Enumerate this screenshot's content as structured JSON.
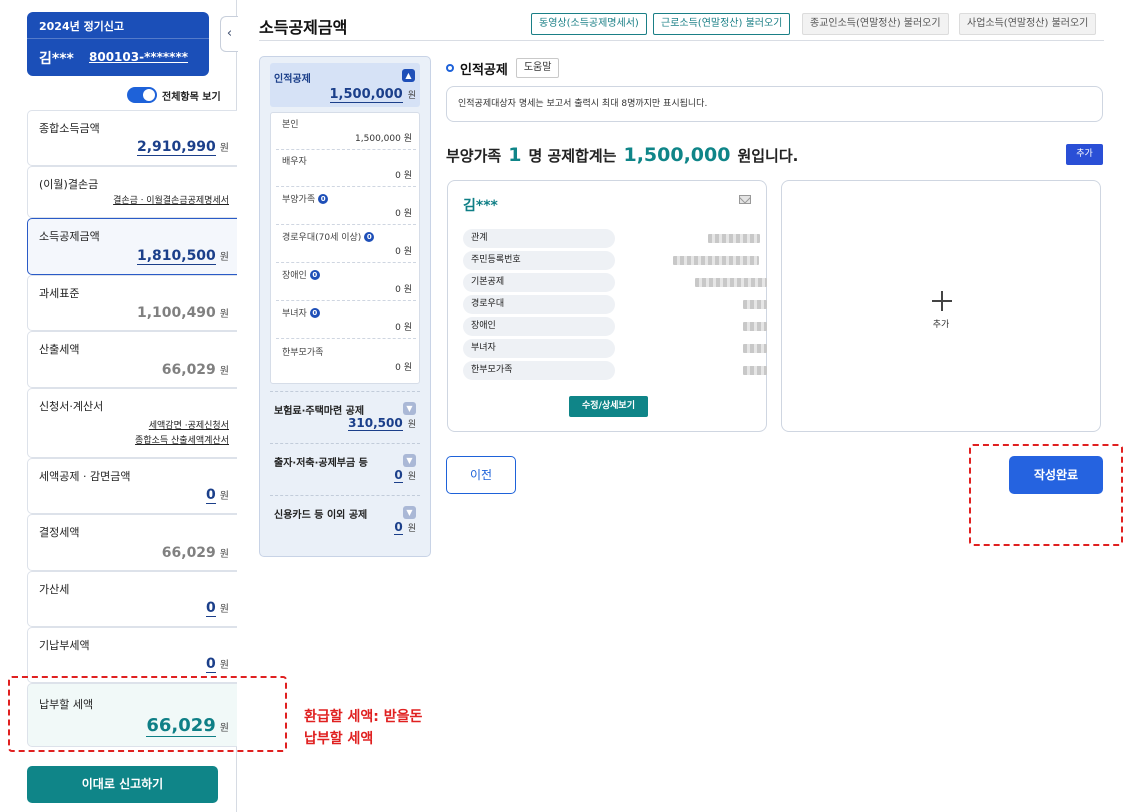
{
  "filing": {
    "year_label": "2024년 정기신고",
    "name": "김***",
    "id": "800103-*******"
  },
  "toggle": {
    "label": "전체항목 보기"
  },
  "sidebar": {
    "items": [
      {
        "title": "종합소득금액",
        "value": "2,910,990",
        "unit": "원"
      },
      {
        "title": "(이월)결손금",
        "links": [
          "결손금ㆍ이월결손금공제명세서"
        ]
      },
      {
        "title": "소득공제금액",
        "value": "1,810,500",
        "unit": "원"
      },
      {
        "title": "과세표준",
        "value": "1,100,490",
        "unit": "원"
      },
      {
        "title": "산출세액",
        "value": "66,029",
        "unit": "원"
      },
      {
        "title": "신청서·계산서",
        "links": [
          "세액감면 ·공제신청서",
          "종합소득 산출세액계산서"
        ]
      },
      {
        "title": "세액공제 · 감면금액",
        "value": "0",
        "unit": "원"
      },
      {
        "title": "결정세액",
        "value": "66,029",
        "unit": "원"
      },
      {
        "title": "가산세",
        "value": "0",
        "unit": "원"
      },
      {
        "title": "기납부세액",
        "value": "0",
        "unit": "원"
      },
      {
        "title": "납부할 세액",
        "value": "66,029",
        "unit": "원"
      }
    ],
    "report_button": "이대로 신고하기"
  },
  "annotation": {
    "line1": "환급할 세액: 받을돈",
    "line2": "납부할 세액"
  },
  "header": {
    "title": "소득공제금액",
    "buttons": [
      "동영상(소득공제명세서)",
      "근로소득(연말정산) 불러오기",
      "종교인소득(연말정산) 불러오기",
      "사업소득(연말정산) 불러오기"
    ]
  },
  "deductions": {
    "head": {
      "label": "인적공제",
      "value": "1,500,000",
      "unit": "원"
    },
    "sub_items": [
      {
        "label": "본인",
        "value": "1,500,000 원",
        "info": ""
      },
      {
        "label": "배우자",
        "value": "0 원",
        "info": ""
      },
      {
        "label": "부양가족",
        "value": "0 원",
        "info": "0"
      },
      {
        "label": "경로우대(70세 이상)",
        "value": "0 원",
        "info": "0"
      },
      {
        "label": "장애인",
        "value": "0 원",
        "info": "0"
      },
      {
        "label": "부녀자",
        "value": "0 원",
        "info": "0"
      },
      {
        "label": "한부모가족",
        "value": "0 원",
        "info": ""
      }
    ],
    "groups": [
      {
        "label": "보험료·주택마련 공제",
        "value": "310,500",
        "unit": "원"
      },
      {
        "label": "출자·저축·공제부금 등",
        "value": "0",
        "unit": "원"
      },
      {
        "label": "신용카드 등 이외 공제",
        "value": "0",
        "unit": "원"
      }
    ]
  },
  "main": {
    "section_title": "인적공제",
    "help_label": "도움말",
    "notice": "인적공제대상자 명세는 보고서 출력시 최대 8명까지만 표시됩니다.",
    "summary": {
      "prefix": "부양가족",
      "count": "1",
      "middle": "명 공제합계는",
      "amount": "1,500,000",
      "suffix": "원입니다."
    },
    "add_button": "추가",
    "person": {
      "name": "김***",
      "fields": [
        "관계",
        "주민등록번호",
        "기본공제",
        "경로우대",
        "장애인",
        "부녀자",
        "한부모가족"
      ],
      "edit_button": "수정/상세보기"
    },
    "add_card_label": "추가",
    "prev_button": "이전",
    "complete_button": "작성완료"
  },
  "colors": {
    "brand_blue": "#1b4fb8",
    "teal": "#0f8588",
    "annotation_red": "#e02020"
  }
}
